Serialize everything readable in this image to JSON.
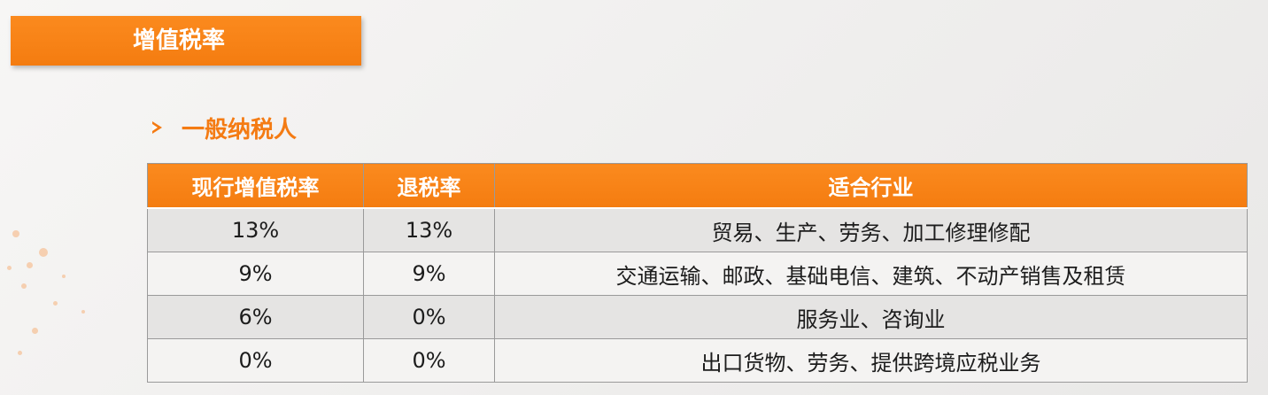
{
  "banner": {
    "title": "增值税率"
  },
  "section": {
    "heading": "一般纳税人"
  },
  "table": {
    "headers": [
      "现行增值税率",
      "退税率",
      "适合行业"
    ],
    "rows": [
      {
        "rate": "13%",
        "refund": "13%",
        "industry": "贸易、生产、劳务、加工修理修配"
      },
      {
        "rate": "9%",
        "refund": "9%",
        "industry": "交通运输、邮政、基础电信、建筑、不动产销售及租赁"
      },
      {
        "rate": "6%",
        "refund": "0%",
        "industry": "服务业、咨询业"
      },
      {
        "rate": "0%",
        "refund": "0%",
        "industry": "出口货物、劳务、提供跨境应税业务"
      }
    ]
  },
  "colors": {
    "accent": "#f47b13",
    "header_text": "#ffffff",
    "row_alt": "#e5e4e3"
  }
}
